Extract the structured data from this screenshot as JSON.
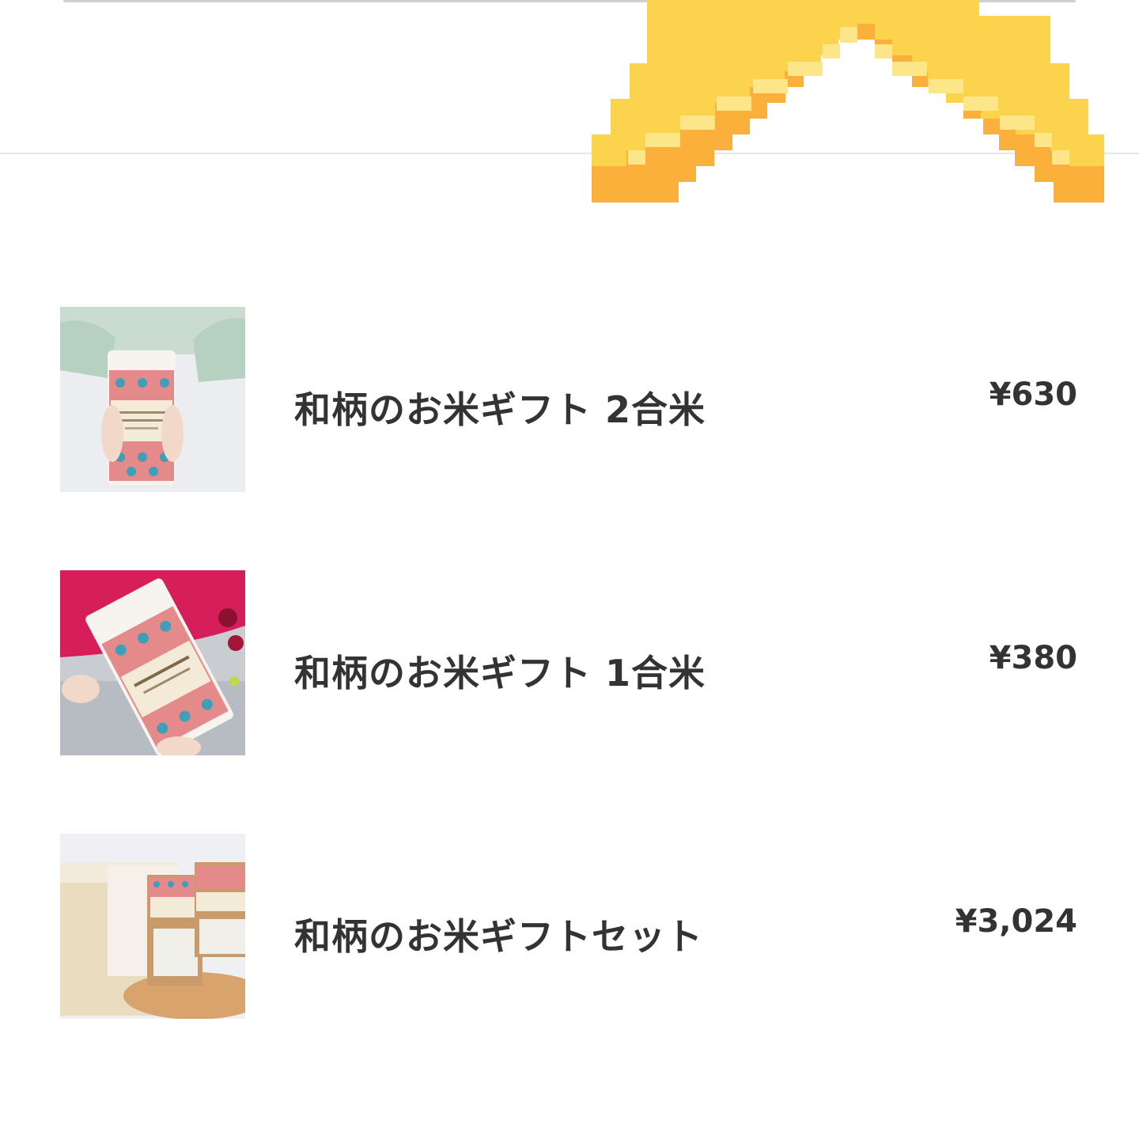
{
  "products": [
    {
      "name": "和柄のお米ギフト 2合米",
      "price": "¥630",
      "image": "rice-bag-2go-photo"
    },
    {
      "name": "和柄のお米ギフト 1合米",
      "price": "¥380",
      "image": "rice-bag-1go-photo"
    },
    {
      "name": "和柄のお米ギフトセット",
      "price": "¥3,024",
      "image": "rice-gift-set-box-photo"
    }
  ],
  "colors": {
    "text": "#333333",
    "sticker_yellow": "#FCD34D",
    "sticker_light": "#FDE68A",
    "sticker_orange": "#FBB03B",
    "divider": "#E6E6E6"
  }
}
